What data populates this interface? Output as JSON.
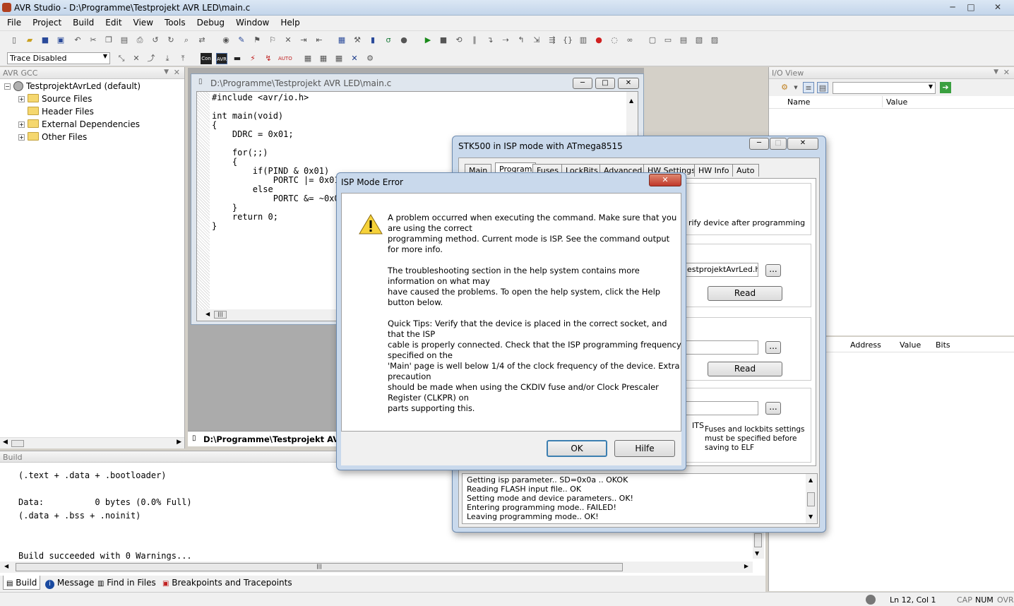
{
  "app": {
    "title": "AVR Studio - D:\\Programme\\Testprojekt AVR LED\\main.c",
    "win_min": "─",
    "win_max": "□",
    "win_close": "✕"
  },
  "menu": [
    "File",
    "Project",
    "Build",
    "Edit",
    "View",
    "Tools",
    "Debug",
    "Window",
    "Help"
  ],
  "toolbar2": {
    "trace_select": "Trace Disabled"
  },
  "project_panel": {
    "header": "AVR GCC",
    "root": "TestprojektAvrLed (default)",
    "items": [
      "Source Files",
      "Header Files",
      "External Dependencies",
      "Other Files"
    ]
  },
  "editor": {
    "title": "D:\\Programme\\Testprojekt AVR LED\\main.c",
    "tab_label": "D:\\Programme\\Testprojekt AVR LED\\main.c",
    "code": "#include <avr/io.h>\n\nint main(void)\n{\n    DDRC = 0x01;\n\n    for(;;)\n    {\n        if(PIND & 0x01)\n            PORTC |= 0x01;\n        else\n            PORTC &= ~0x01;\n    }\n    return 0;\n}"
  },
  "io_view": {
    "header": "I/O View",
    "col_name": "Name",
    "col_value": "Value",
    "col_address": "Address",
    "col_value2": "Value",
    "col_bits": "Bits"
  },
  "stk500": {
    "title": "STK500 in ISP mode with ATmega8515",
    "tabs": [
      "Main",
      "Program",
      "Fuses",
      "LockBits",
      "Advanced",
      "HW Settings",
      "HW Info",
      "Auto"
    ],
    "verify_label": "rify device after programming",
    "hex_file": "estprojektAvrLed.hex",
    "browse": "...",
    "read1": "Read",
    "read2": "Read",
    "elf_prefix": "ITS",
    "elf_note": "Fuses and lockbits settings must be specified before saving to ELF",
    "log": [
      "Getting isp parameter.. SD=0x0a .. OKOK",
      "Reading FLASH input file.. OK",
      "Setting mode and device parameters.. OK!",
      "Entering programming mode.. FAILED!",
      "Leaving programming mode.. OK!"
    ]
  },
  "error_dialog": {
    "title": "ISP Mode Error",
    "close": "✕",
    "message": "A problem occurred when executing the command. Make sure that you\nare using the correct\nprogramming method. Current mode is ISP. See the command output\nfor more info.\n\nThe troubleshooting section in the help system contains more\ninformation on what may\nhave caused the problems. To open the help system, click the Help\nbutton below.\n\nQuick Tips: Verify that the device is placed in the correct socket, and\nthat the ISP\ncable is properly connected. Check that the ISP programming frequency\nspecified on the\n'Main' page is well below 1/4 of the clock frequency of the device. Extra\nprecaution\nshould be made when using the CKDIV fuse and/or Clock Prescaler\nRegister (CLKPR) on\nparts supporting this.",
    "ok": "OK",
    "help": "Hilfe"
  },
  "build": {
    "header": "Build",
    "output": "(.text + .data + .bootloader)\n\nData:          0 bytes (0.0% Full)\n(.data + .bss + .noinit)\n\n\nBuild succeeded with 0 Warnings...",
    "tabs": [
      "Build",
      "Message",
      "Find in Files",
      "Breakpoints and Tracepoints"
    ]
  },
  "statusbar": {
    "position": "Ln 12, Col 1",
    "cap": "CAP",
    "num": "NUM",
    "ovr": "OVR"
  }
}
